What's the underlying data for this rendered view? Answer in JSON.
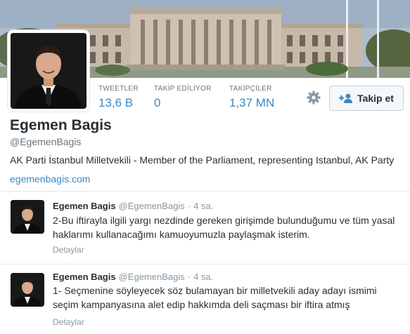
{
  "profile": {
    "name": "Egemen Bagis",
    "handle": "@EgemenBagis",
    "bio": "AK Parti İstanbul Milletvekili - Member of the Parliament, representing Istanbul, AK Party",
    "website": "egemenbagis.com"
  },
  "stats": {
    "tweets_label": "TWEETLER",
    "tweets_value": "13,6 B",
    "following_label": "TAKİP EDİLİYOR",
    "following_value": "0",
    "followers_label": "TAKİPÇİLER",
    "followers_value": "1,37 MN"
  },
  "actions": {
    "follow_label": "Takip et",
    "settings_icon": "gear-icon",
    "follow_icon": "add-user-icon"
  },
  "tweets": [
    {
      "name": "Egemen Bagis",
      "handle": "@EgemenBagis",
      "separator": "·",
      "time": "4 sa.",
      "line1": "2-Bu iftirayla ilgili yargı nezdinde gereken girişimde bulunduğumu ve tüm yasal",
      "line2": "haklarımı kullanacağımı kamuoyumuzla paylaşmak isterim.",
      "details": "Detaylar"
    },
    {
      "name": "Egemen Bagis",
      "handle": "@EgemenBagis",
      "separator": "·",
      "time": "4 sa.",
      "line1": "1- Seçmenine söyleyecek söz bulamayan bir milletvekili aday adayı ismimi",
      "line2": "seçim kampanyasına alet edip hakkımda deli saçması bir iftira atmış",
      "details": "Detaylar"
    }
  ],
  "colors": {
    "link": "#3b88c3",
    "muted": "#66757f",
    "text": "#292f33",
    "border": "#e1e8ed"
  }
}
